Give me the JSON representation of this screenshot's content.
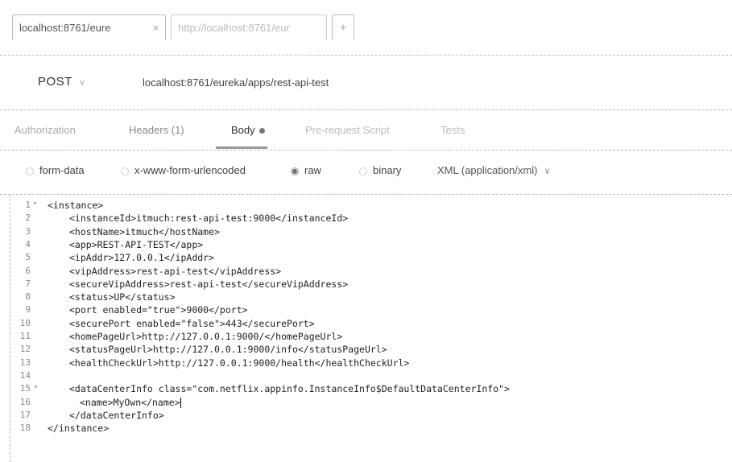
{
  "tabs": [
    {
      "label": "localhost:8761/eure",
      "close": "×"
    },
    {
      "label": "http://localhost:8761/eur"
    },
    {
      "label": "+"
    }
  ],
  "request": {
    "method": "POST",
    "url": "localhost:8761/eureka/apps/rest-api-test"
  },
  "request_tabs": {
    "authorization": "Authorization",
    "headers": "Headers (1)",
    "body": "Body",
    "prerequest": "Pre-request Script",
    "tests": "Tests"
  },
  "body_options": {
    "form_data": "form-data",
    "urlencoded": "x-www-form-urlencoded",
    "raw": "raw",
    "binary": "binary",
    "content_type": "XML (application/xml)",
    "selected": "raw"
  },
  "editor": {
    "lines": [
      {
        "n": "1",
        "text": "<instance>",
        "fold": true,
        "indent": 0
      },
      {
        "n": "2",
        "text": "<instanceId>itmuch:rest-api-test:9000</instanceId>",
        "indent": 1
      },
      {
        "n": "3",
        "text": "<hostName>itmuch</hostName>",
        "indent": 1
      },
      {
        "n": "4",
        "text": "<app>REST-API-TEST</app>",
        "indent": 1
      },
      {
        "n": "5",
        "text": "<ipAddr>127.0.0.1</ipAddr>",
        "indent": 1
      },
      {
        "n": "6",
        "text": "<vipAddress>rest-api-test</vipAddress>",
        "indent": 1
      },
      {
        "n": "7",
        "text": "<secureVipAddress>rest-api-test</secureVipAddress>",
        "indent": 1
      },
      {
        "n": "8",
        "text": "<status>UP</status>",
        "indent": 1
      },
      {
        "n": "9",
        "text": "<port enabled=\"true\">9000</port>",
        "indent": 1
      },
      {
        "n": "10",
        "text": "<securePort enabled=\"false\">443</securePort>",
        "indent": 1
      },
      {
        "n": "11",
        "text": "<homePageUrl>http://127.0.0.1:9000/</homePageUrl>",
        "indent": 1
      },
      {
        "n": "12",
        "text": "<statusPageUrl>http://127.0.0.1:9000/info</statusPageUrl>",
        "indent": 1
      },
      {
        "n": "13",
        "text": "<healthCheckUrl>http://127.0.0.1:9000/health</healthCheckUrl>",
        "indent": 1
      },
      {
        "n": "14",
        "text": "",
        "indent": 1
      },
      {
        "n": "15",
        "text": "<dataCenterInfo class=\"com.netflix.appinfo.InstanceInfo$DefaultDataCenterInfo\">",
        "fold": true,
        "indent": 1
      },
      {
        "n": "16",
        "text": "<name>MyOwn</name>",
        "indent": 2,
        "cursor": true
      },
      {
        "n": "17",
        "text": "</dataCenterInfo>",
        "indent": 1
      },
      {
        "n": "18",
        "text": "</instance>",
        "indent": 0
      }
    ]
  }
}
